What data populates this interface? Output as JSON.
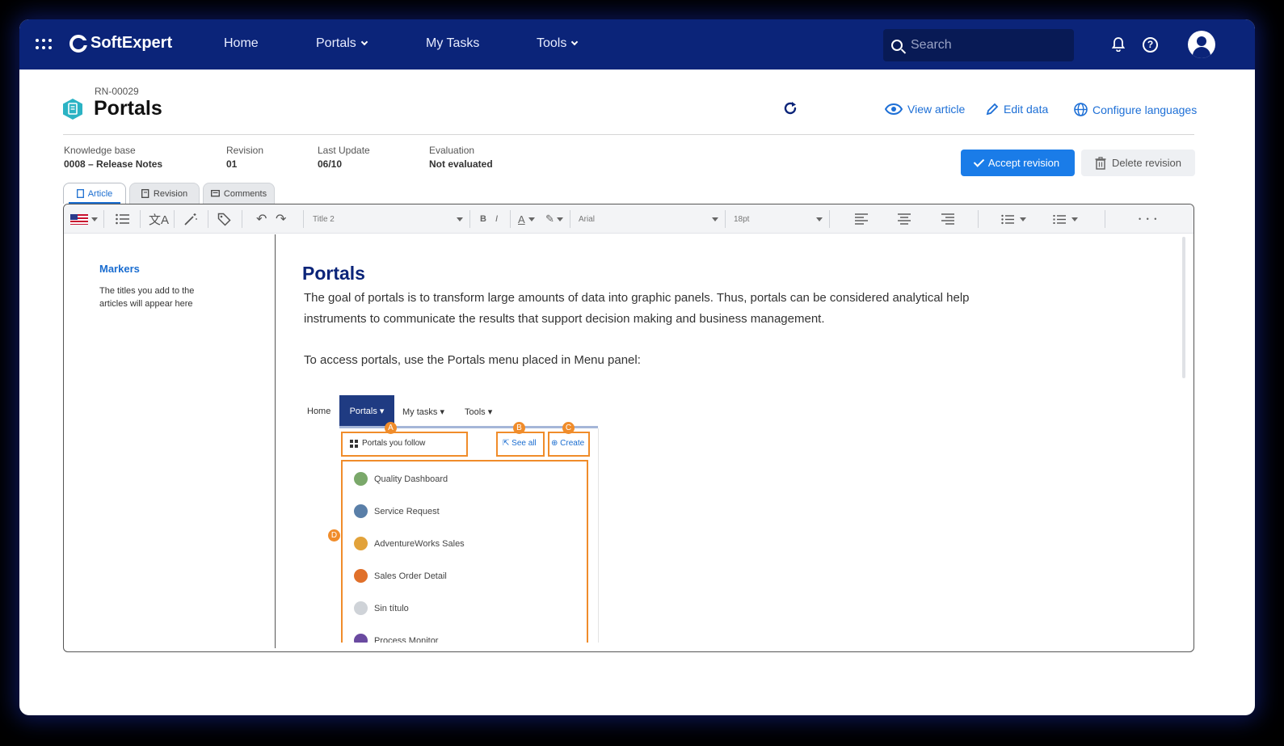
{
  "brand": {
    "name": "SoftExpert"
  },
  "nav": {
    "items": [
      {
        "label": "Home",
        "has_dropdown": false
      },
      {
        "label": "Portals",
        "has_dropdown": true
      },
      {
        "label": "My Tasks",
        "has_dropdown": false
      },
      {
        "label": "Tools",
        "has_dropdown": true
      }
    ],
    "search_placeholder": "Search"
  },
  "header": {
    "code": "RN-00029",
    "title": "Portals",
    "actions": {
      "view_article": "View article",
      "edit_data": "Edit data",
      "configure_languages": "Configure languages"
    }
  },
  "meta": [
    {
      "key": "Knowledge base",
      "value": "0008 – Release Notes"
    },
    {
      "key": "Revision",
      "value": "01"
    },
    {
      "key": "Last Update",
      "value": "06/10"
    },
    {
      "key": "Evaluation",
      "value": "Not evaluated"
    }
  ],
  "buttons": {
    "accept": "Accept revision",
    "delete": "Delete revision"
  },
  "tabs": [
    {
      "label": "Article",
      "active": true
    },
    {
      "label": "Revision",
      "active": false
    },
    {
      "label": "Comments",
      "active": false
    }
  ],
  "toolbar": {
    "style": "Title 2",
    "bold": "B",
    "italic": "I",
    "font_color": "A",
    "font": "Arial",
    "size": "18pt",
    "more": "• • •"
  },
  "sidebar": {
    "title": "Markers",
    "text": "The titles you add to the articles will appear here"
  },
  "article": {
    "heading": "Portals",
    "paragraph1": "The goal of portals is to transform large amounts of data into graphic panels. Thus, portals can be considered analytical help instruments to communicate the results that support decision making and business management.",
    "paragraph2": "To access portals, use the Portals menu placed in Menu panel:"
  },
  "screenshot": {
    "menu": [
      "Home",
      "Portals ▾",
      "My tasks ▾",
      "Tools ▾"
    ],
    "badges": [
      "A",
      "B",
      "C",
      "D"
    ],
    "follow": "Portals you follow",
    "see_all": "See all",
    "create": "Create",
    "items": [
      {
        "label": "Quality Dashboard",
        "color": "#7aa86a"
      },
      {
        "label": "Service Request",
        "color": "#5a7fa8"
      },
      {
        "label": "AdventureWorks Sales",
        "color": "#e2a23a"
      },
      {
        "label": "Sales Order Detail",
        "color": "#e0702a"
      },
      {
        "label": "Sin título",
        "color": "#cfd3d8"
      },
      {
        "label": "Process Monitor",
        "color": "#6a4aa0"
      }
    ]
  }
}
